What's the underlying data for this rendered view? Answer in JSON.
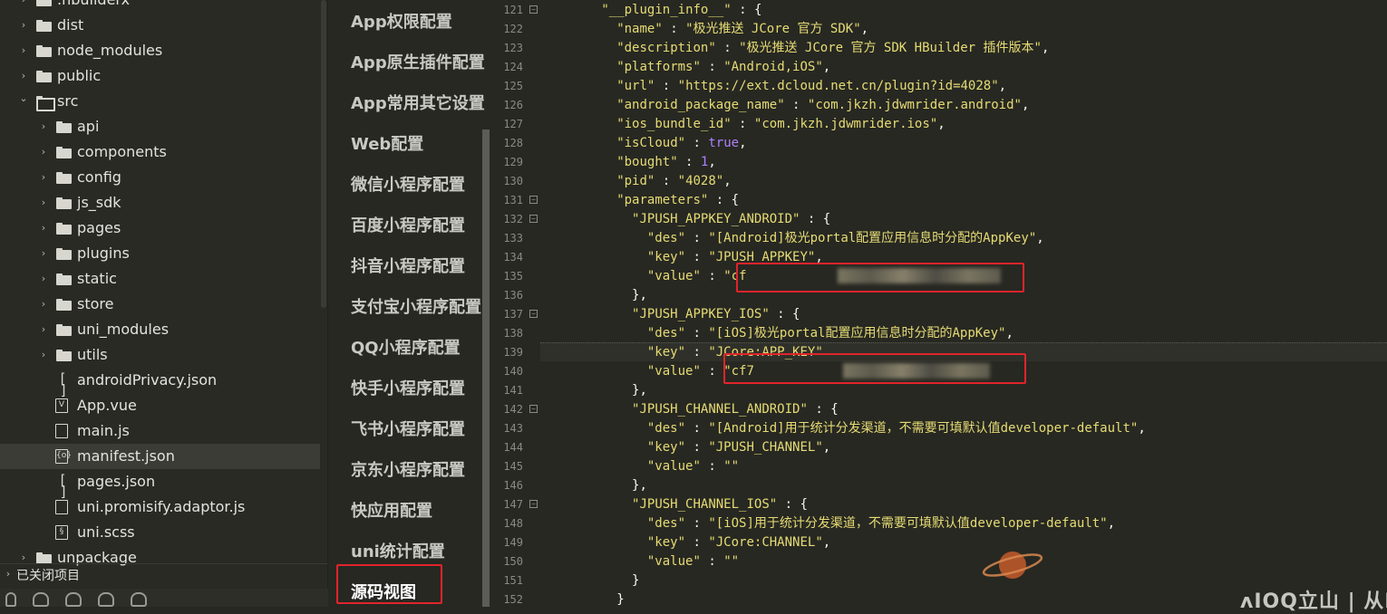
{
  "explorer": {
    "items": [
      {
        "label": ".hbuilderx",
        "type": "folder",
        "depth": 1,
        "expanded": false
      },
      {
        "label": "dist",
        "type": "folder",
        "depth": 1,
        "expanded": false
      },
      {
        "label": "node_modules",
        "type": "folder",
        "depth": 1,
        "expanded": false
      },
      {
        "label": "public",
        "type": "folder",
        "depth": 1,
        "expanded": false
      },
      {
        "label": "src",
        "type": "folder",
        "depth": 1,
        "expanded": true
      },
      {
        "label": "api",
        "type": "folder",
        "depth": 2,
        "expanded": false
      },
      {
        "label": "components",
        "type": "folder",
        "depth": 2,
        "expanded": false
      },
      {
        "label": "config",
        "type": "folder",
        "depth": 2,
        "expanded": false
      },
      {
        "label": "js_sdk",
        "type": "folder",
        "depth": 2,
        "expanded": false
      },
      {
        "label": "pages",
        "type": "folder",
        "depth": 2,
        "expanded": false
      },
      {
        "label": "plugins",
        "type": "folder",
        "depth": 2,
        "expanded": false
      },
      {
        "label": "static",
        "type": "folder",
        "depth": 2,
        "expanded": false
      },
      {
        "label": "store",
        "type": "folder",
        "depth": 2,
        "expanded": false
      },
      {
        "label": "uni_modules",
        "type": "folder",
        "depth": 2,
        "expanded": false
      },
      {
        "label": "utils",
        "type": "folder",
        "depth": 2,
        "expanded": false
      },
      {
        "label": "androidPrivacy.json",
        "type": "file",
        "icon": "[ ]",
        "depth": 2
      },
      {
        "label": "App.vue",
        "type": "file",
        "icon": "V",
        "depth": 2
      },
      {
        "label": "main.js",
        "type": "file",
        "icon": "",
        "depth": 2
      },
      {
        "label": "manifest.json",
        "type": "file",
        "icon": "{o}",
        "depth": 2,
        "selected": true
      },
      {
        "label": "pages.json",
        "type": "file",
        "icon": "[ ]",
        "depth": 2
      },
      {
        "label": "uni.promisify.adaptor.js",
        "type": "file",
        "icon": "",
        "depth": 2
      },
      {
        "label": "uni.scss",
        "type": "file",
        "icon": "§",
        "depth": 2
      },
      {
        "label": "unpackage",
        "type": "folder",
        "depth": 1,
        "expanded": false
      }
    ],
    "closed_projects": "已关闭项目"
  },
  "settings_nav": {
    "items": [
      "App权限配置",
      "App原生插件配置",
      "App常用其它设置",
      "Web配置",
      "微信小程序配置",
      "百度小程序配置",
      "抖音小程序配置",
      "支付宝小程序配置",
      "QQ小程序配置",
      "快手小程序配置",
      "飞书小程序配置",
      "京东小程序配置",
      "快应用配置",
      "uni统计配置",
      "源码视图"
    ],
    "active": "源码视图"
  },
  "editor": {
    "lines": [
      {
        "n": 121,
        "fold": true,
        "i": 8,
        "t": [
          [
            "s",
            "\"__plugin_info__\""
          ],
          [
            "p",
            " : {"
          ]
        ]
      },
      {
        "n": 122,
        "i": 10,
        "t": [
          [
            "s",
            "\"name\""
          ],
          [
            "p",
            " : "
          ],
          [
            "s",
            "\"极光推送 JCore 官方 SDK\""
          ],
          [
            "p",
            ","
          ]
        ]
      },
      {
        "n": 123,
        "i": 10,
        "t": [
          [
            "s",
            "\"description\""
          ],
          [
            "p",
            " : "
          ],
          [
            "s",
            "\"极光推送 JCore 官方 SDK HBuilder 插件版本\""
          ],
          [
            "p",
            ","
          ]
        ]
      },
      {
        "n": 124,
        "i": 10,
        "t": [
          [
            "s",
            "\"platforms\""
          ],
          [
            "p",
            " : "
          ],
          [
            "s",
            "\"Android,iOS\""
          ],
          [
            "p",
            ","
          ]
        ]
      },
      {
        "n": 125,
        "i": 10,
        "t": [
          [
            "s",
            "\"url\""
          ],
          [
            "p",
            " : "
          ],
          [
            "s",
            "\"https://ext.dcloud.net.cn/plugin?id=4028\""
          ],
          [
            "p",
            ","
          ]
        ]
      },
      {
        "n": 126,
        "i": 10,
        "t": [
          [
            "s",
            "\"android_package_name\""
          ],
          [
            "p",
            " : "
          ],
          [
            "s",
            "\"com.jkzh.jdwmrider.android\""
          ],
          [
            "p",
            ","
          ]
        ]
      },
      {
        "n": 127,
        "i": 10,
        "t": [
          [
            "s",
            "\"ios_bundle_id\""
          ],
          [
            "p",
            " : "
          ],
          [
            "s",
            "\"com.jkzh.jdwmrider.ios\""
          ],
          [
            "p",
            ","
          ]
        ]
      },
      {
        "n": 128,
        "i": 10,
        "t": [
          [
            "s",
            "\"isCloud\""
          ],
          [
            "p",
            " : "
          ],
          [
            "b",
            "true"
          ],
          [
            "p",
            ","
          ]
        ]
      },
      {
        "n": 129,
        "i": 10,
        "t": [
          [
            "s",
            "\"bought\""
          ],
          [
            "p",
            " : "
          ],
          [
            "b",
            "1"
          ],
          [
            "p",
            ","
          ]
        ]
      },
      {
        "n": 130,
        "i": 10,
        "t": [
          [
            "s",
            "\"pid\""
          ],
          [
            "p",
            " : "
          ],
          [
            "s",
            "\"4028\""
          ],
          [
            "p",
            ","
          ]
        ]
      },
      {
        "n": 131,
        "fold": true,
        "i": 10,
        "t": [
          [
            "s",
            "\"parameters\""
          ],
          [
            "p",
            " : {"
          ]
        ]
      },
      {
        "n": 132,
        "fold": true,
        "i": 12,
        "t": [
          [
            "s",
            "\"JPUSH_APPKEY_ANDROID\""
          ],
          [
            "p",
            " : {"
          ]
        ]
      },
      {
        "n": 133,
        "i": 14,
        "t": [
          [
            "s",
            "\"des\""
          ],
          [
            "p",
            " : "
          ],
          [
            "s",
            "\"[Android]极光portal配置应用信息时分配的AppKey\""
          ],
          [
            "p",
            ","
          ]
        ]
      },
      {
        "n": 134,
        "i": 14,
        "t": [
          [
            "s",
            "\"key\""
          ],
          [
            "p",
            " : "
          ],
          [
            "s",
            "\"JPUSH_APPKEY\""
          ],
          [
            "p",
            ","
          ]
        ]
      },
      {
        "n": 135,
        "i": 14,
        "t": [
          [
            "s",
            "\"value\""
          ],
          [
            "p",
            " : "
          ],
          [
            "s",
            "\"cf"
          ]
        ]
      },
      {
        "n": 136,
        "i": 12,
        "t": [
          [
            "p",
            "},"
          ]
        ]
      },
      {
        "n": 137,
        "fold": true,
        "i": 12,
        "t": [
          [
            "s",
            "\"JPUSH_APPKEY_IOS\""
          ],
          [
            "p",
            " : {"
          ]
        ]
      },
      {
        "n": 138,
        "i": 14,
        "t": [
          [
            "s",
            "\"des\""
          ],
          [
            "p",
            " : "
          ],
          [
            "s",
            "\"[iOS]极光portal配置应用信息时分配的AppKey\""
          ],
          [
            "p",
            ","
          ]
        ]
      },
      {
        "n": 139,
        "i": 14,
        "t": [
          [
            "s",
            "\"key\""
          ],
          [
            "p",
            " : "
          ],
          [
            "s",
            "\"JCore:APP_KEY\""
          ]
        ]
      },
      {
        "n": 140,
        "i": 14,
        "t": [
          [
            "s",
            "\"value\""
          ],
          [
            "p",
            " : "
          ],
          [
            "s",
            "\"cf7"
          ]
        ]
      },
      {
        "n": 141,
        "i": 12,
        "t": [
          [
            "p",
            "},"
          ]
        ]
      },
      {
        "n": 142,
        "fold": true,
        "i": 12,
        "t": [
          [
            "s",
            "\"JPUSH_CHANNEL_ANDROID\""
          ],
          [
            "p",
            " : {"
          ]
        ]
      },
      {
        "n": 143,
        "i": 14,
        "t": [
          [
            "s",
            "\"des\""
          ],
          [
            "p",
            " : "
          ],
          [
            "s",
            "\"[Android]用于统计分发渠道，不需要可填默认值developer-default\""
          ],
          [
            "p",
            ","
          ]
        ]
      },
      {
        "n": 144,
        "i": 14,
        "t": [
          [
            "s",
            "\"key\""
          ],
          [
            "p",
            " : "
          ],
          [
            "s",
            "\"JPUSH_CHANNEL\""
          ],
          [
            "p",
            ","
          ]
        ]
      },
      {
        "n": 145,
        "i": 14,
        "t": [
          [
            "s",
            "\"value\""
          ],
          [
            "p",
            " : "
          ],
          [
            "s",
            "\"\""
          ]
        ]
      },
      {
        "n": 146,
        "i": 12,
        "t": [
          [
            "p",
            "},"
          ]
        ]
      },
      {
        "n": 147,
        "fold": true,
        "i": 12,
        "t": [
          [
            "s",
            "\"JPUSH_CHANNEL_IOS\""
          ],
          [
            "p",
            " : {"
          ]
        ]
      },
      {
        "n": 148,
        "i": 14,
        "t": [
          [
            "s",
            "\"des\""
          ],
          [
            "p",
            " : "
          ],
          [
            "s",
            "\"[iOS]用于统计分发渠道，不需要可填默认值developer-default\""
          ],
          [
            "p",
            ","
          ]
        ]
      },
      {
        "n": 149,
        "i": 14,
        "t": [
          [
            "s",
            "\"key\""
          ],
          [
            "p",
            " : "
          ],
          [
            "s",
            "\"JCore:CHANNEL\""
          ],
          [
            "p",
            ","
          ]
        ]
      },
      {
        "n": 150,
        "i": 14,
        "t": [
          [
            "s",
            "\"value\""
          ],
          [
            "p",
            " : "
          ],
          [
            "s",
            "\"\""
          ]
        ]
      },
      {
        "n": 151,
        "i": 12,
        "t": [
          [
            "p",
            "}"
          ]
        ]
      },
      {
        "n": 152,
        "i": 10,
        "t": [
          [
            "p",
            "}"
          ]
        ]
      }
    ],
    "redacted_tail_135": "\"",
    "redacted_tail_140": "o\""
  },
  "colors": {
    "background": "#272822",
    "string": "#e6db74",
    "boolean_number": "#ae81ff",
    "highlight_box": "#e0242b"
  },
  "watermark": "ʌIOQ立山 | 从I"
}
